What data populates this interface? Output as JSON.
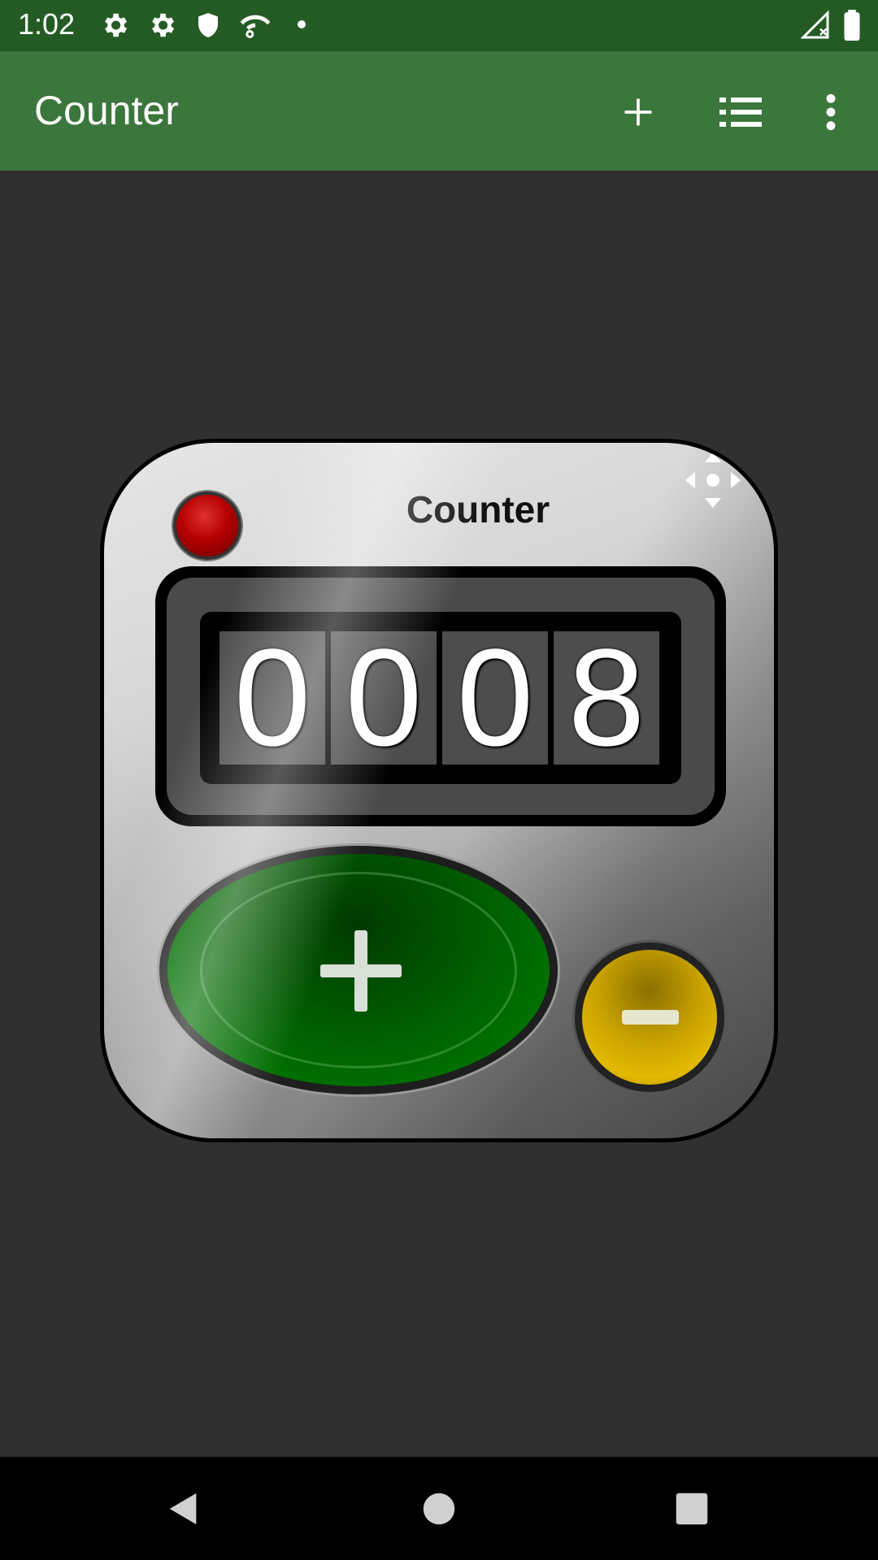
{
  "status_bar": {
    "time": "1:02",
    "icons": [
      "settings-icon",
      "settings-icon",
      "shield-icon",
      "wifi-settings-icon",
      "dot-icon",
      "signal-icon",
      "battery-icon"
    ]
  },
  "app_bar": {
    "title": "Counter",
    "actions": [
      "add-icon",
      "list-icon",
      "more-vert-icon"
    ]
  },
  "counter": {
    "name": "Counter",
    "digits": [
      "0",
      "0",
      "0",
      "8"
    ],
    "increment_icon": "plus-icon",
    "decrement_icon": "minus-icon",
    "indicator_color": "#b50000",
    "increment_color": "#007400",
    "decrement_color": "#e3b900"
  },
  "nav_bar": {
    "buttons": [
      "back-icon",
      "home-icon",
      "recents-icon"
    ]
  },
  "colors": {
    "status_bar": "#245b25",
    "app_bar": "#3b763c",
    "background": "#303030"
  }
}
